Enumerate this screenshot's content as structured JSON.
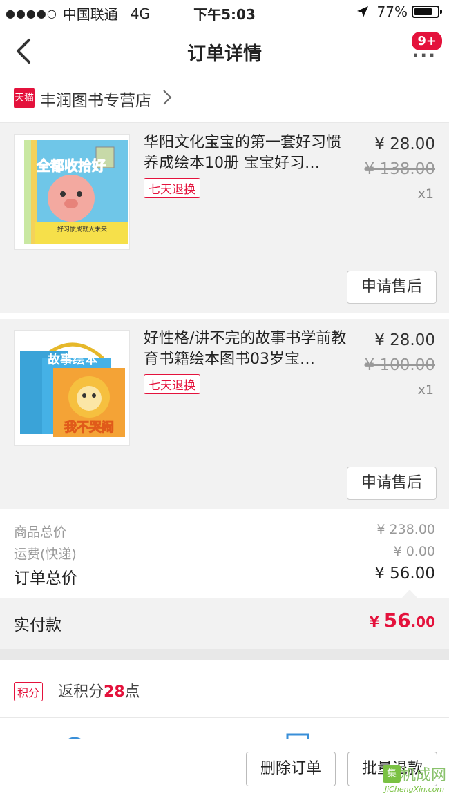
{
  "status": {
    "carrier": "中国联通",
    "network": "4G",
    "time": "下午5:03",
    "battery": "77%",
    "battery_level": 0.77
  },
  "nav": {
    "title": "订单详情",
    "badge": "9+",
    "more": "···"
  },
  "shop": {
    "badge": "天猫",
    "name": "丰润图书专营店"
  },
  "items": [
    {
      "title": "华阳文化宝宝的第一套好习惯养成绘本10册 宝宝好习…",
      "tag": "七天退换",
      "price": "¥ 28.00",
      "original_price": "¥ 138.00",
      "quantity": "x1",
      "after_sale": "申请售后",
      "cover_text": "全都收拾好",
      "cover_banner": "好习惯成就大未来"
    },
    {
      "title": "好性格/讲不完的故事书学前教育书籍绘本图书03岁宝…",
      "tag": "七天退换",
      "price": "¥ 28.00",
      "original_price": "¥ 100.00",
      "quantity": "x1",
      "after_sale": "申请售后",
      "cover_text": "故事绘本",
      "cover_subtext": "我不哭闹"
    }
  ],
  "summary": {
    "goods_total_label": "商品总价",
    "goods_total": "¥ 238.00",
    "shipping_label": "运费(快递)",
    "shipping": "¥ 0.00",
    "order_total_label": "订单总价",
    "order_total": "¥ 56.00",
    "paid_label": "实付款",
    "paid_currency": "¥ ",
    "paid_int": "56",
    "paid_dec": ".00"
  },
  "points": {
    "tag": "积分",
    "prefix": "返积分",
    "value": "28",
    "suffix": "点"
  },
  "bottom": {
    "delete_label": "删除订单",
    "refund_label": "批量退款"
  },
  "watermark": {
    "mark": "集",
    "cn": "机成网",
    "en": "JiChengXin.com"
  },
  "colors": {
    "accent": "#e4123c",
    "panel": "#f2f2f2"
  }
}
